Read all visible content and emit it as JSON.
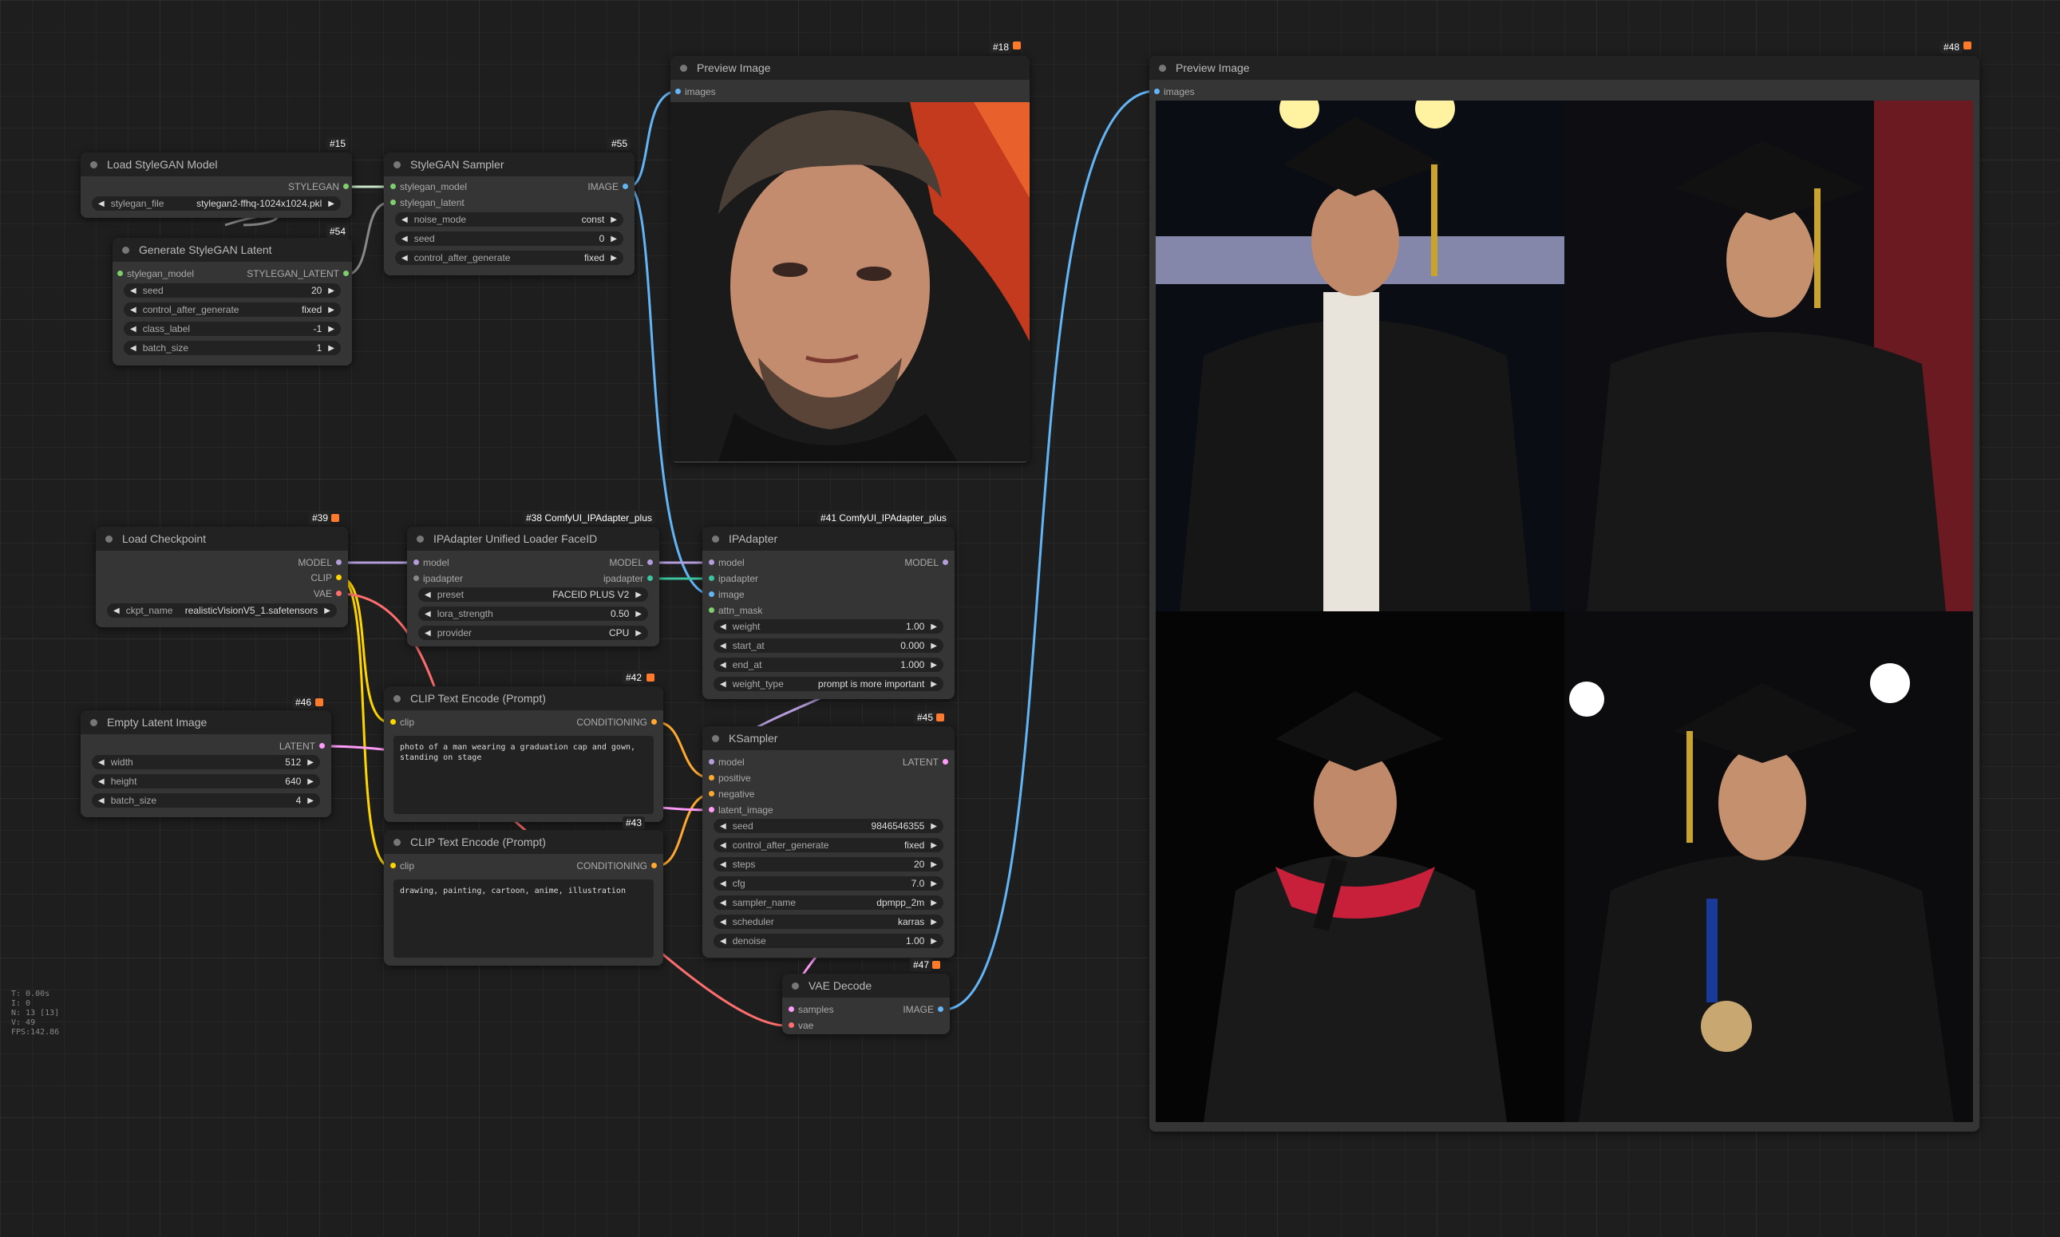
{
  "nodes": {
    "load_stylegan": {
      "title": "Load StyleGAN Model",
      "badge": "#15",
      "out": "STYLEGAN",
      "widget": {
        "label": "stylegan_file",
        "value": "stylegan2-ffhq-1024x1024.pkl"
      }
    },
    "gen_latent": {
      "title": "Generate StyleGAN Latent",
      "badge": "#54",
      "in": "stylegan_model",
      "out": "STYLEGAN_LATENT",
      "widgets": [
        {
          "label": "seed",
          "value": "20"
        },
        {
          "label": "control_after_generate",
          "value": "fixed"
        },
        {
          "label": "class_label",
          "value": "-1"
        },
        {
          "label": "batch_size",
          "value": "1"
        }
      ]
    },
    "stylegan_sampler": {
      "title": "StyleGAN Sampler",
      "badge": "#55",
      "in1": "stylegan_model",
      "in2": "stylegan_latent",
      "out": "IMAGE",
      "widgets": [
        {
          "label": "noise_mode",
          "value": "const"
        },
        {
          "label": "seed",
          "value": "0"
        },
        {
          "label": "control_after_generate",
          "value": "fixed"
        }
      ]
    },
    "preview18": {
      "title": "Preview Image",
      "badge": "#18",
      "in": "images"
    },
    "preview48": {
      "title": "Preview Image",
      "badge": "#48",
      "in": "images"
    },
    "load_ckpt": {
      "title": "Load Checkpoint",
      "badge": "#39",
      "outs": [
        "MODEL",
        "CLIP",
        "VAE"
      ],
      "widget": {
        "label": "ckpt_name",
        "value": "realisticVisionV5_1.safetensors"
      }
    },
    "ipa_loader": {
      "title": "IPAdapter Unified Loader FaceID",
      "badge": "#38 ComfyUI_IPAdapter_plus",
      "ins": [
        "model",
        "ipadapter"
      ],
      "outs": [
        "MODEL",
        "ipadapter"
      ],
      "widgets": [
        {
          "label": "preset",
          "value": "FACEID PLUS V2"
        },
        {
          "label": "lora_strength",
          "value": "0.50"
        },
        {
          "label": "provider",
          "value": "CPU"
        }
      ]
    },
    "ipadapter": {
      "title": "IPAdapter",
      "badge": "#41 ComfyUI_IPAdapter_plus",
      "ins": [
        "model",
        "ipadapter",
        "image",
        "attn_mask"
      ],
      "out": "MODEL",
      "widgets": [
        {
          "label": "weight",
          "value": "1.00"
        },
        {
          "label": "start_at",
          "value": "0.000"
        },
        {
          "label": "end_at",
          "value": "1.000"
        },
        {
          "label": "weight_type",
          "value": "prompt is more important"
        }
      ]
    },
    "clip_pos": {
      "title": "CLIP Text Encode (Prompt)",
      "badge": "#42",
      "in": "clip",
      "out": "CONDITIONING",
      "text": "photo of a man wearing a graduation cap and gown, standing on stage"
    },
    "clip_neg": {
      "title": "CLIP Text Encode (Prompt)",
      "badge": "#43",
      "in": "clip",
      "out": "CONDITIONING",
      "text": "drawing, painting, cartoon, anime, illustration"
    },
    "empty_latent": {
      "title": "Empty Latent Image",
      "badge": "#46",
      "out": "LATENT",
      "widgets": [
        {
          "label": "width",
          "value": "512"
        },
        {
          "label": "height",
          "value": "640"
        },
        {
          "label": "batch_size",
          "value": "4"
        }
      ]
    },
    "ksampler": {
      "title": "KSampler",
      "badge": "#45",
      "ins": [
        "model",
        "positive",
        "negative",
        "latent_image"
      ],
      "out": "LATENT",
      "widgets": [
        {
          "label": "seed",
          "value": "9846546355"
        },
        {
          "label": "control_after_generate",
          "value": "fixed"
        },
        {
          "label": "steps",
          "value": "20"
        },
        {
          "label": "cfg",
          "value": "7.0"
        },
        {
          "label": "sampler_name",
          "value": "dpmpp_2m"
        },
        {
          "label": "scheduler",
          "value": "karras"
        },
        {
          "label": "denoise",
          "value": "1.00"
        }
      ]
    },
    "vae_decode": {
      "title": "VAE Decode",
      "badge": "#47",
      "ins": [
        "samples",
        "vae"
      ],
      "out": "IMAGE"
    }
  },
  "stats": [
    "T: 0.00s",
    "I: 0",
    "N: 13 [13]",
    "V: 49",
    "FPS:142.86"
  ],
  "colors": {
    "clip": "#ffd500",
    "model": "#b39ddb",
    "latent": "#ff9cf9",
    "image": "#64b5f6",
    "vae": "#ff6e6e",
    "conditioning": "#ffa931",
    "stylegan": "#7fce6e",
    "ipadapter": "#3cc4a0"
  }
}
